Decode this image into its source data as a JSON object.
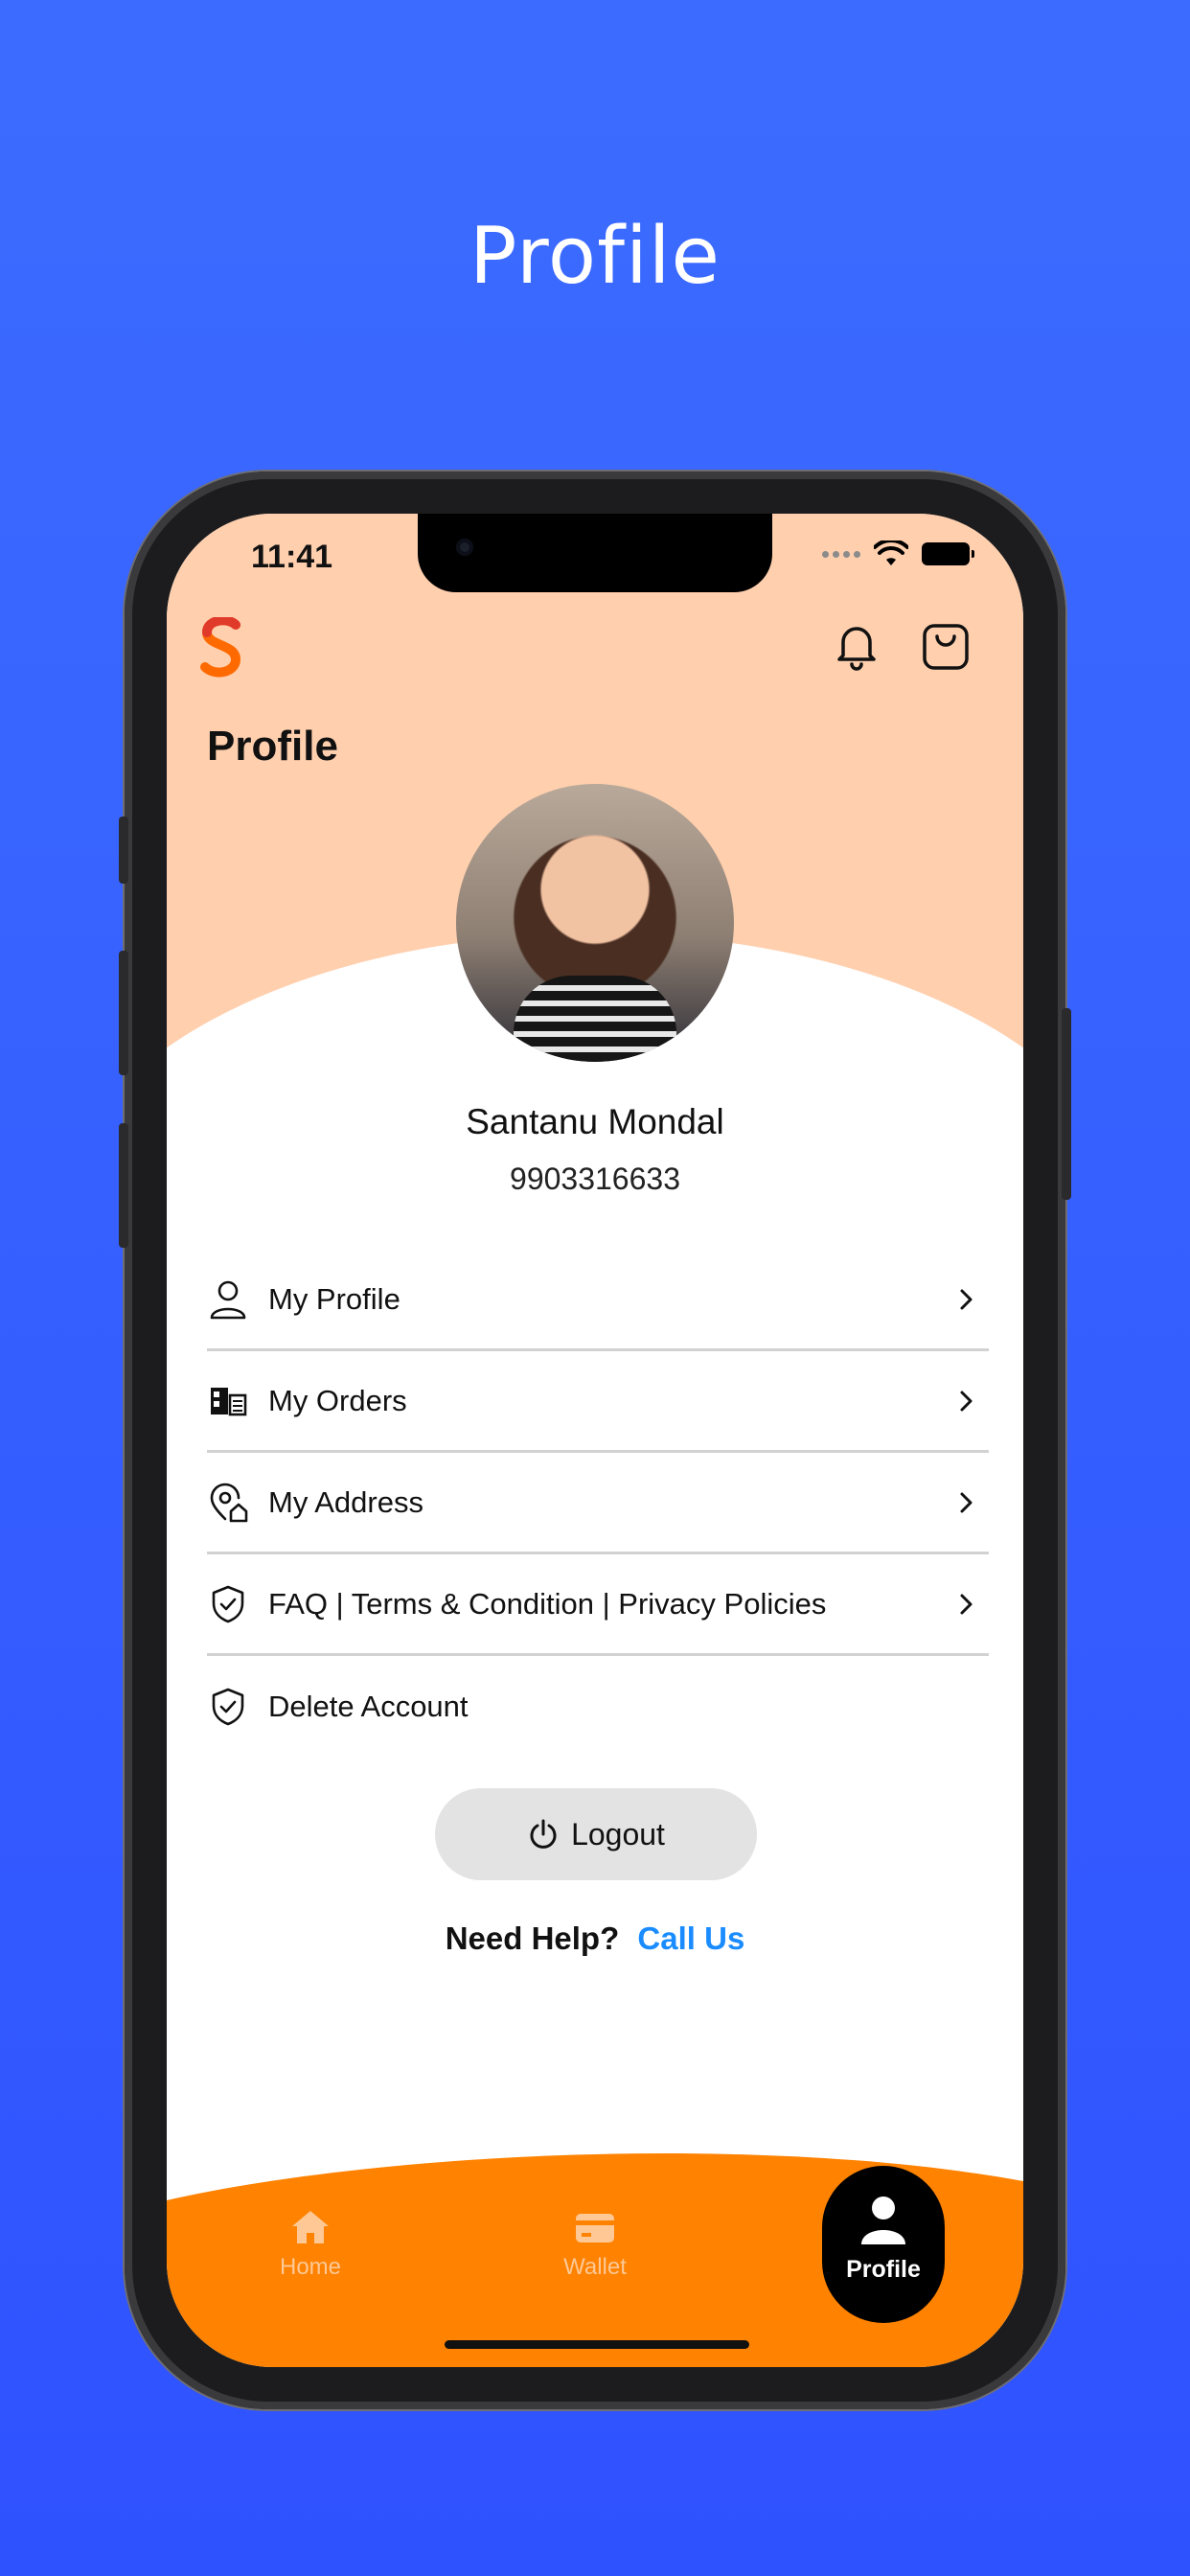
{
  "headline": "Profile",
  "status_bar": {
    "time": "11:41"
  },
  "header": {
    "title": "Profile"
  },
  "user": {
    "name": "Santanu Mondal",
    "phone": "9903316633"
  },
  "menu": {
    "items": [
      {
        "label": "My Profile",
        "icon": "user-icon"
      },
      {
        "label": "My Orders",
        "icon": "orders-icon"
      },
      {
        "label": "My Address",
        "icon": "address-icon"
      },
      {
        "label": "FAQ | Terms & Condition | Privacy Policies",
        "icon": "shield-check-icon"
      },
      {
        "label": "Delete Account",
        "icon": "shield-check-icon"
      }
    ]
  },
  "logout": {
    "label": "Logout"
  },
  "help": {
    "text": "Need Help?",
    "link": "Call Us"
  },
  "nav": {
    "items": [
      {
        "label": "Home",
        "icon": "home-icon"
      },
      {
        "label": "Wallet",
        "icon": "wallet-icon"
      },
      {
        "label": "Profile",
        "icon": "profile-icon",
        "active": true
      }
    ]
  },
  "colors": {
    "background": "#3c6cff",
    "hero": "#ffcfae",
    "nav_bar": "#ff8200",
    "link": "#1a8cff"
  }
}
